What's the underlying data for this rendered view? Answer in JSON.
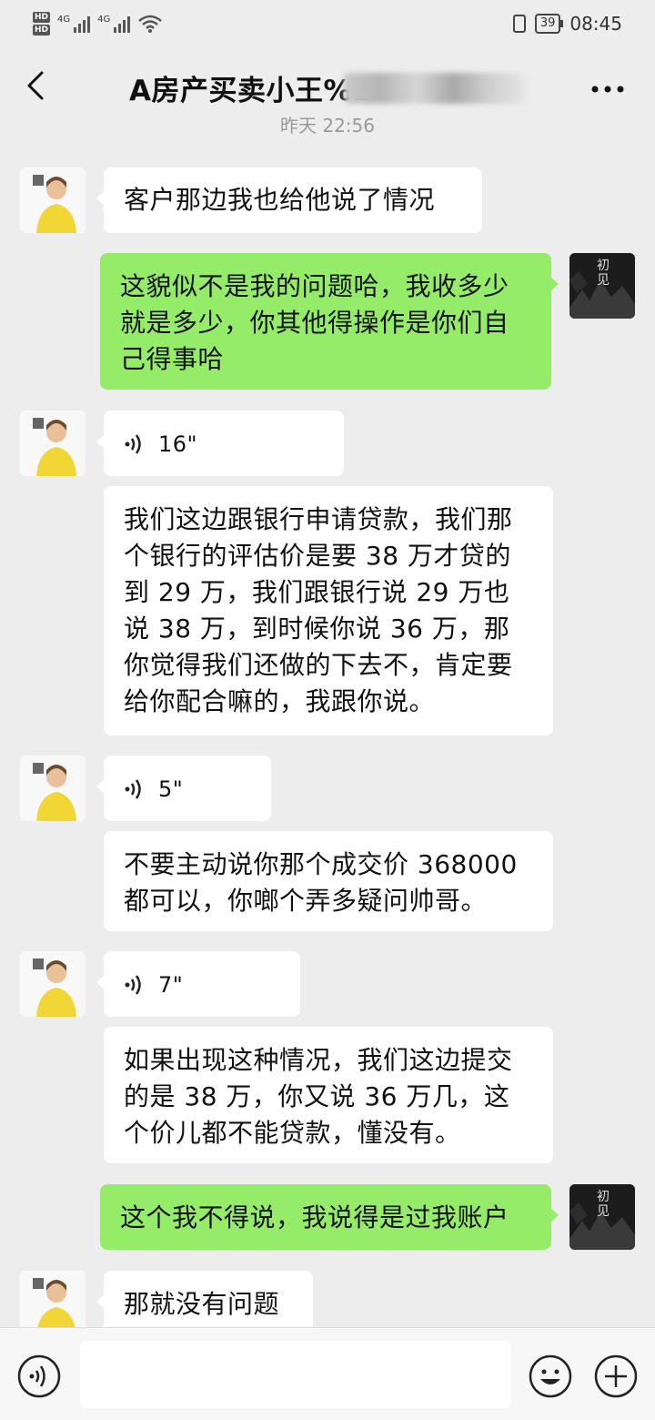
{
  "status_bar": {
    "hd1": "HD",
    "hd2": "HD",
    "net1": "4G",
    "net2": "4G",
    "battery": "39",
    "time": "08:45"
  },
  "header": {
    "title": "A房产买卖小王%1"
  },
  "timestamp": "昨天 22:56",
  "messages": [
    {
      "side": "left",
      "type": "text",
      "text": "客户那边我也给他说了情况"
    },
    {
      "side": "right",
      "type": "text",
      "text": "这貌似不是我的问题哈，我收多少就是多少，你其他得操作是你们自己得事哈"
    },
    {
      "side": "left",
      "type": "voice",
      "duration": "16\""
    },
    {
      "side": "left",
      "type": "text",
      "text": "我们这边跟银行申请贷款，我们那个银行的评估价是要 38 万才贷的到 29 万，我们跟银行说 29 万也说 38 万，到时候你说 36 万，那你觉得我们还做的下去不，肯定要给你配合嘛的，我跟你说。"
    },
    {
      "side": "left",
      "type": "voice",
      "duration": "5\""
    },
    {
      "side": "left",
      "type": "text",
      "text": "不要主动说你那个成交价 368000 都可以，你啷个弄多疑问帅哥。"
    },
    {
      "side": "left",
      "type": "voice",
      "duration": "7\""
    },
    {
      "side": "left",
      "type": "text",
      "text": "如果出现这种情况，我们这边提交的是 38 万，你又说 36 万几，这个价儿都不能贷款，懂没有。"
    },
    {
      "side": "right",
      "type": "text",
      "text": "这个我不得说，我说得是过我账户"
    },
    {
      "side": "left",
      "type": "text",
      "text": "那就没有问题"
    }
  ],
  "self_avatar_text": "初见",
  "colors": {
    "background": "#ededed",
    "self_bubble": "#95ec69",
    "other_bubble": "#ffffff"
  },
  "icons": {
    "back": "chevron-left-icon",
    "more": "more-dots-icon",
    "voice": "voice-wave-icon",
    "emoji": "emoji-icon",
    "plus": "plus-icon"
  }
}
